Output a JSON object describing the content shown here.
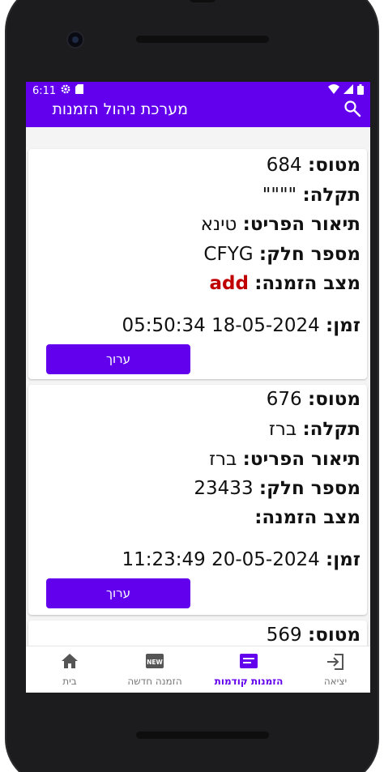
{
  "status_bar": {
    "time": "6:11",
    "icons": [
      "settings-gear-icon",
      "sd-card-icon",
      "wifi-icon",
      "signal-icon",
      "battery-icon"
    ]
  },
  "app_bar": {
    "title": "מערכת ניהול הזמנות",
    "search_icon": "search-icon"
  },
  "labels": {
    "flight": "מטוס:",
    "fault": "תקלה:",
    "item_desc": "תיאור הפריט:",
    "part_number": "מספר חלק:",
    "order_status": "מצב הזמנה:",
    "time": "זמן:",
    "edit": "ערוך"
  },
  "orders": [
    {
      "flight": "684",
      "fault": "\"\"\"\"",
      "item_desc": "טינא",
      "part_number": "CFYG",
      "order_status": "add",
      "time": "18-05-2024 05:50:34"
    },
    {
      "flight": "676",
      "fault": "ברז",
      "item_desc": "ברז",
      "part_number": "23433",
      "order_status": "",
      "time": "20-05-2024 11:23:49"
    },
    {
      "flight": "569"
    }
  ],
  "bottom_nav": [
    {
      "label": "יציאה",
      "icon": "logout-icon",
      "active": false
    },
    {
      "label": "הזמנות קודמות",
      "icon": "orders-list-icon",
      "active": true
    },
    {
      "label": "הזמנה חדשה",
      "icon": "new-badge-icon",
      "active": false
    },
    {
      "label": "בית",
      "icon": "home-icon",
      "active": false
    }
  ],
  "colors": {
    "primary": "#6200ee",
    "status_add": "#c00000"
  }
}
